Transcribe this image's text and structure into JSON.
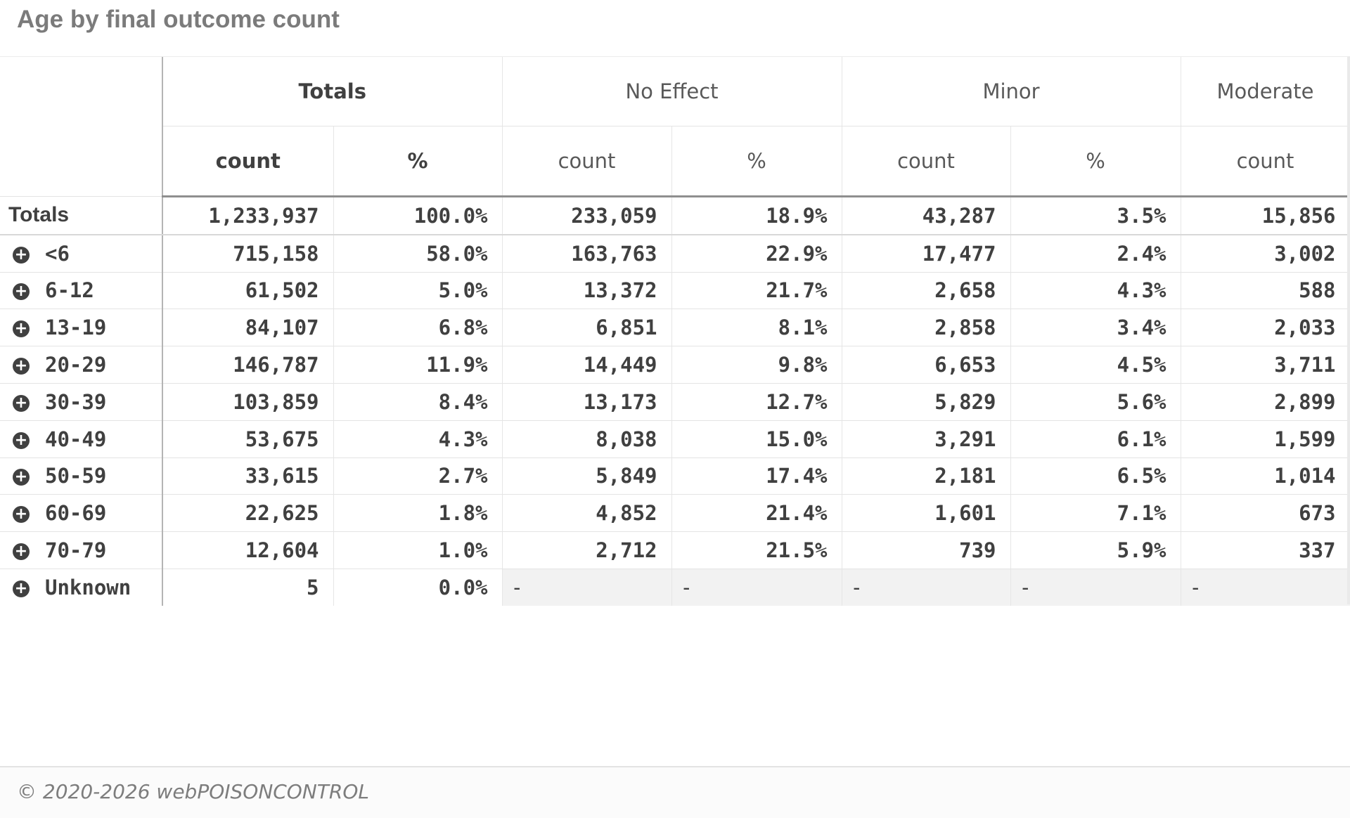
{
  "title": "Age by final outcome count",
  "footer": "© 2020-2026 webPOISONCONTROL",
  "columns": {
    "groups": [
      "Totals",
      "No Effect",
      "Minor",
      "Moderate"
    ],
    "count_label": "count",
    "pct_label": "%"
  },
  "totals": {
    "label": "Totals",
    "values": [
      "1,233,937",
      "100.0%",
      "233,059",
      "18.9%",
      "43,287",
      "3.5%",
      "15,856"
    ]
  },
  "rows": [
    {
      "label": "<6",
      "values": [
        "715,158",
        "58.0%",
        "163,763",
        "22.9%",
        "17,477",
        "2.4%",
        "3,002"
      ]
    },
    {
      "label": "6-12",
      "values": [
        "61,502",
        "5.0%",
        "13,372",
        "21.7%",
        "2,658",
        "4.3%",
        "588"
      ]
    },
    {
      "label": "13-19",
      "values": [
        "84,107",
        "6.8%",
        "6,851",
        "8.1%",
        "2,858",
        "3.4%",
        "2,033"
      ]
    },
    {
      "label": "20-29",
      "values": [
        "146,787",
        "11.9%",
        "14,449",
        "9.8%",
        "6,653",
        "4.5%",
        "3,711"
      ]
    },
    {
      "label": "30-39",
      "values": [
        "103,859",
        "8.4%",
        "13,173",
        "12.7%",
        "5,829",
        "5.6%",
        "2,899"
      ]
    },
    {
      "label": "40-49",
      "values": [
        "53,675",
        "4.3%",
        "8,038",
        "15.0%",
        "3,291",
        "6.1%",
        "1,599"
      ]
    },
    {
      "label": "50-59",
      "values": [
        "33,615",
        "2.7%",
        "5,849",
        "17.4%",
        "2,181",
        "6.5%",
        "1,014"
      ]
    },
    {
      "label": "60-69",
      "values": [
        "22,625",
        "1.8%",
        "4,852",
        "21.4%",
        "1,601",
        "7.1%",
        "673"
      ]
    },
    {
      "label": "70-79",
      "values": [
        "12,604",
        "1.0%",
        "2,712",
        "21.5%",
        "739",
        "5.9%",
        "337"
      ]
    },
    {
      "label": "Unknown",
      "values": [
        "5",
        "0.0%",
        "-",
        "-",
        "-",
        "-",
        "-"
      ]
    }
  ]
}
